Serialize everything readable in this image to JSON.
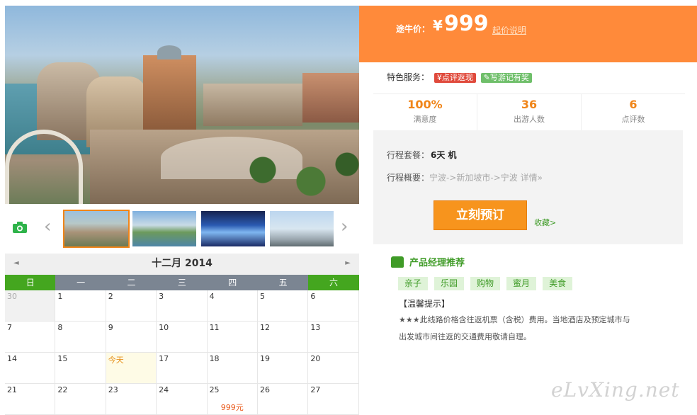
{
  "price": {
    "label": "途牛价：",
    "currency": "¥",
    "amount": "999",
    "explain_link": "起价说明"
  },
  "services": {
    "label": "特色服务：",
    "tag1": "¥点评返现",
    "tag2": "✎写游记有奖"
  },
  "stats": [
    {
      "value": "100%",
      "label": "满意度"
    },
    {
      "value": "36",
      "label": "出游人数"
    },
    {
      "value": "6",
      "label": "点评数"
    }
  ],
  "trip": {
    "package_label": "行程套餐：",
    "package_value": "6天  机",
    "overview_label": "行程概要：",
    "overview_value": "宁波->新加坡市->宁波",
    "details_link": "详情»"
  },
  "actions": {
    "book": "立刻预订",
    "favorite": "收藏>"
  },
  "recommend": {
    "title": "产品经理推荐",
    "tags": [
      "亲子",
      "乐园",
      "购物",
      "蜜月",
      "美食"
    ],
    "tip_title": "【温馨提示】",
    "tip_lines": [
      "★★★此线路价格含往返机票（含税）费用。当地酒店及预定城市与",
      "出发城市间往返的交通费用敬请自理。"
    ]
  },
  "calendar": {
    "month_title": "十二月 2014",
    "prev": "◄",
    "next": "►",
    "weekdays": [
      "日",
      "一",
      "二",
      "三",
      "四",
      "五",
      "六"
    ],
    "rows": [
      [
        "30",
        "1",
        "2",
        "3",
        "4",
        "5",
        "6"
      ],
      [
        "7",
        "8",
        "9",
        "10",
        "11",
        "12",
        "13"
      ],
      [
        "14",
        "15",
        "今天",
        "17",
        "18",
        "19",
        "20"
      ],
      [
        "21",
        "22",
        "23",
        "24",
        "25",
        "26",
        "27"
      ]
    ],
    "price_note": "999元"
  },
  "gallery": {
    "camera_icon": "camera-icon",
    "prev_arrow": "‹",
    "next_arrow": "›"
  },
  "watermark": "eLvXing.net",
  "colors": {
    "accent": "#ff8a3a",
    "green": "#44a61f",
    "weekday_bar": "#7b8592"
  }
}
